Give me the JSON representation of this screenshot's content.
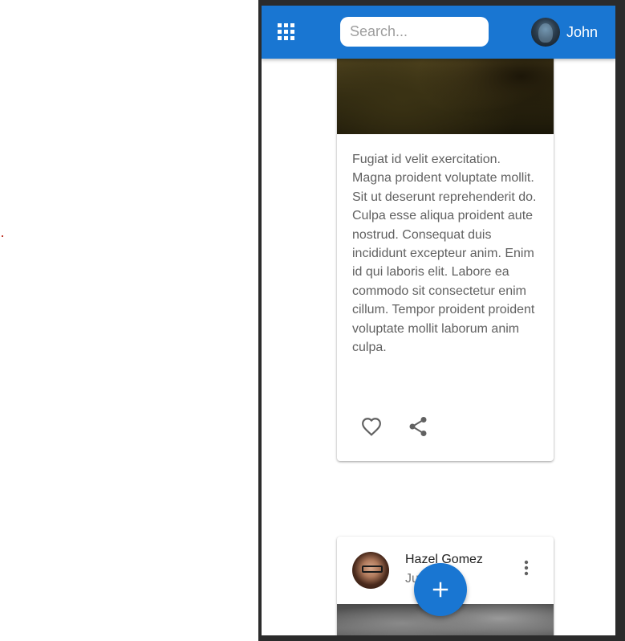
{
  "app_bar": {
    "menu_icon": "apps-grid-icon",
    "search_placeholder": "Search...",
    "user_name": "John",
    "accent_color": "#1976d2"
  },
  "post_1": {
    "body": "Fugiat id velit exercitation. Magna proident voluptate mollit. Sit ut deserunt reprehenderit do. Culpa esse aliqua proident aute nostrud. Consequat duis incididunt excepteur anim. Enim id qui laboris elit. Labore ea commodo sit consectetur enim cillum. Tempor proident proident voluptate mollit laborum anim culpa.",
    "actions": [
      "heart-icon",
      "share-icon"
    ]
  },
  "post_2": {
    "author": "Hazel Gomez",
    "date": "Ju    023",
    "menu_icon": "more-vertical-icon"
  },
  "fab": {
    "icon": "plus-icon"
  }
}
